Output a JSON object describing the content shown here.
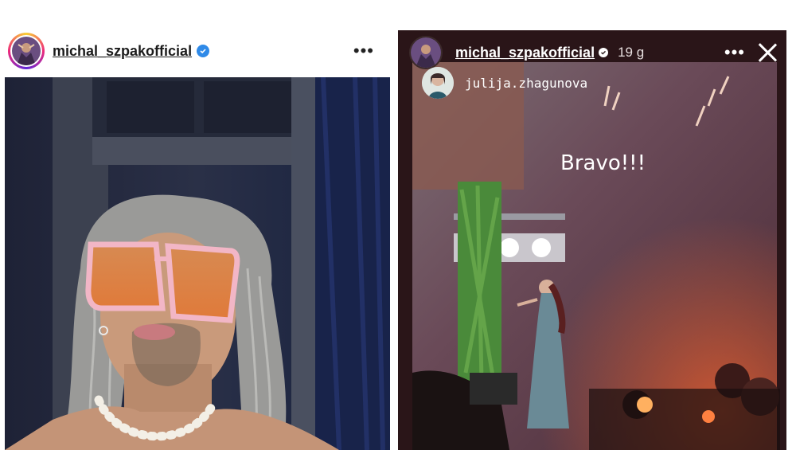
{
  "post": {
    "username": "michal_szpakofficial",
    "more_label": "•••"
  },
  "story": {
    "username": "michal_szpakofficial",
    "time": "19 g",
    "more_label": "•••",
    "mention": "julija.zhagunova",
    "overlay_text": "Bravo!!!"
  },
  "colors": {
    "verified": "#2f8ae8",
    "story_bg": "#1c0d0d"
  }
}
